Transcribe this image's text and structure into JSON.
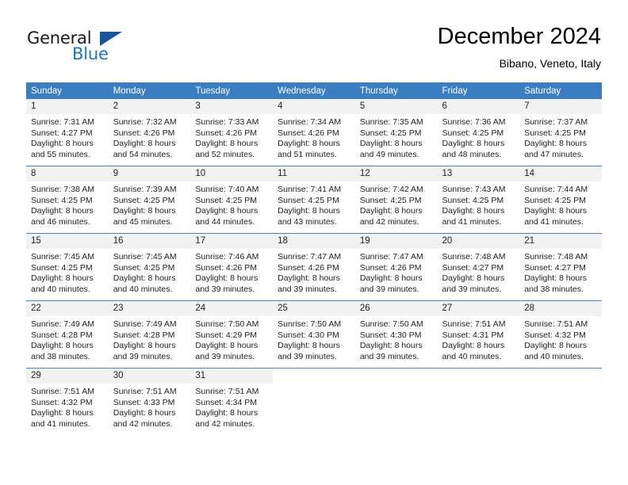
{
  "brand": {
    "line1": "General",
    "line2": "Blue",
    "triangle_color": "#15569e",
    "blue_text_color": "#1878c8"
  },
  "header": {
    "title": "December 2024",
    "location": "Bibano, Veneto, Italy"
  },
  "theme": {
    "header_row_bg": "#3a7ec1",
    "daynum_bg": "#f2f2f2",
    "row_divider": "#4a84bf"
  },
  "weekday_headers": [
    "Sunday",
    "Monday",
    "Tuesday",
    "Wednesday",
    "Thursday",
    "Friday",
    "Saturday"
  ],
  "weeks": [
    [
      {
        "day": "1",
        "sunrise": "Sunrise: 7:31 AM",
        "sunset": "Sunset: 4:27 PM",
        "daylight1": "Daylight: 8 hours",
        "daylight2": "and 55 minutes."
      },
      {
        "day": "2",
        "sunrise": "Sunrise: 7:32 AM",
        "sunset": "Sunset: 4:26 PM",
        "daylight1": "Daylight: 8 hours",
        "daylight2": "and 54 minutes."
      },
      {
        "day": "3",
        "sunrise": "Sunrise: 7:33 AM",
        "sunset": "Sunset: 4:26 PM",
        "daylight1": "Daylight: 8 hours",
        "daylight2": "and 52 minutes."
      },
      {
        "day": "4",
        "sunrise": "Sunrise: 7:34 AM",
        "sunset": "Sunset: 4:26 PM",
        "daylight1": "Daylight: 8 hours",
        "daylight2": "and 51 minutes."
      },
      {
        "day": "5",
        "sunrise": "Sunrise: 7:35 AM",
        "sunset": "Sunset: 4:25 PM",
        "daylight1": "Daylight: 8 hours",
        "daylight2": "and 49 minutes."
      },
      {
        "day": "6",
        "sunrise": "Sunrise: 7:36 AM",
        "sunset": "Sunset: 4:25 PM",
        "daylight1": "Daylight: 8 hours",
        "daylight2": "and 48 minutes."
      },
      {
        "day": "7",
        "sunrise": "Sunrise: 7:37 AM",
        "sunset": "Sunset: 4:25 PM",
        "daylight1": "Daylight: 8 hours",
        "daylight2": "and 47 minutes."
      }
    ],
    [
      {
        "day": "8",
        "sunrise": "Sunrise: 7:38 AM",
        "sunset": "Sunset: 4:25 PM",
        "daylight1": "Daylight: 8 hours",
        "daylight2": "and 46 minutes."
      },
      {
        "day": "9",
        "sunrise": "Sunrise: 7:39 AM",
        "sunset": "Sunset: 4:25 PM",
        "daylight1": "Daylight: 8 hours",
        "daylight2": "and 45 minutes."
      },
      {
        "day": "10",
        "sunrise": "Sunrise: 7:40 AM",
        "sunset": "Sunset: 4:25 PM",
        "daylight1": "Daylight: 8 hours",
        "daylight2": "and 44 minutes."
      },
      {
        "day": "11",
        "sunrise": "Sunrise: 7:41 AM",
        "sunset": "Sunset: 4:25 PM",
        "daylight1": "Daylight: 8 hours",
        "daylight2": "and 43 minutes."
      },
      {
        "day": "12",
        "sunrise": "Sunrise: 7:42 AM",
        "sunset": "Sunset: 4:25 PM",
        "daylight1": "Daylight: 8 hours",
        "daylight2": "and 42 minutes."
      },
      {
        "day": "13",
        "sunrise": "Sunrise: 7:43 AM",
        "sunset": "Sunset: 4:25 PM",
        "daylight1": "Daylight: 8 hours",
        "daylight2": "and 41 minutes."
      },
      {
        "day": "14",
        "sunrise": "Sunrise: 7:44 AM",
        "sunset": "Sunset: 4:25 PM",
        "daylight1": "Daylight: 8 hours",
        "daylight2": "and 41 minutes."
      }
    ],
    [
      {
        "day": "15",
        "sunrise": "Sunrise: 7:45 AM",
        "sunset": "Sunset: 4:25 PM",
        "daylight1": "Daylight: 8 hours",
        "daylight2": "and 40 minutes."
      },
      {
        "day": "16",
        "sunrise": "Sunrise: 7:45 AM",
        "sunset": "Sunset: 4:25 PM",
        "daylight1": "Daylight: 8 hours",
        "daylight2": "and 40 minutes."
      },
      {
        "day": "17",
        "sunrise": "Sunrise: 7:46 AM",
        "sunset": "Sunset: 4:26 PM",
        "daylight1": "Daylight: 8 hours",
        "daylight2": "and 39 minutes."
      },
      {
        "day": "18",
        "sunrise": "Sunrise: 7:47 AM",
        "sunset": "Sunset: 4:26 PM",
        "daylight1": "Daylight: 8 hours",
        "daylight2": "and 39 minutes."
      },
      {
        "day": "19",
        "sunrise": "Sunrise: 7:47 AM",
        "sunset": "Sunset: 4:26 PM",
        "daylight1": "Daylight: 8 hours",
        "daylight2": "and 39 minutes."
      },
      {
        "day": "20",
        "sunrise": "Sunrise: 7:48 AM",
        "sunset": "Sunset: 4:27 PM",
        "daylight1": "Daylight: 8 hours",
        "daylight2": "and 39 minutes."
      },
      {
        "day": "21",
        "sunrise": "Sunrise: 7:48 AM",
        "sunset": "Sunset: 4:27 PM",
        "daylight1": "Daylight: 8 hours",
        "daylight2": "and 38 minutes."
      }
    ],
    [
      {
        "day": "22",
        "sunrise": "Sunrise: 7:49 AM",
        "sunset": "Sunset: 4:28 PM",
        "daylight1": "Daylight: 8 hours",
        "daylight2": "and 38 minutes."
      },
      {
        "day": "23",
        "sunrise": "Sunrise: 7:49 AM",
        "sunset": "Sunset: 4:28 PM",
        "daylight1": "Daylight: 8 hours",
        "daylight2": "and 39 minutes."
      },
      {
        "day": "24",
        "sunrise": "Sunrise: 7:50 AM",
        "sunset": "Sunset: 4:29 PM",
        "daylight1": "Daylight: 8 hours",
        "daylight2": "and 39 minutes."
      },
      {
        "day": "25",
        "sunrise": "Sunrise: 7:50 AM",
        "sunset": "Sunset: 4:30 PM",
        "daylight1": "Daylight: 8 hours",
        "daylight2": "and 39 minutes."
      },
      {
        "day": "26",
        "sunrise": "Sunrise: 7:50 AM",
        "sunset": "Sunset: 4:30 PM",
        "daylight1": "Daylight: 8 hours",
        "daylight2": "and 39 minutes."
      },
      {
        "day": "27",
        "sunrise": "Sunrise: 7:51 AM",
        "sunset": "Sunset: 4:31 PM",
        "daylight1": "Daylight: 8 hours",
        "daylight2": "and 40 minutes."
      },
      {
        "day": "28",
        "sunrise": "Sunrise: 7:51 AM",
        "sunset": "Sunset: 4:32 PM",
        "daylight1": "Daylight: 8 hours",
        "daylight2": "and 40 minutes."
      }
    ],
    [
      {
        "day": "29",
        "sunrise": "Sunrise: 7:51 AM",
        "sunset": "Sunset: 4:32 PM",
        "daylight1": "Daylight: 8 hours",
        "daylight2": "and 41 minutes."
      },
      {
        "day": "30",
        "sunrise": "Sunrise: 7:51 AM",
        "sunset": "Sunset: 4:33 PM",
        "daylight1": "Daylight: 8 hours",
        "daylight2": "and 42 minutes."
      },
      {
        "day": "31",
        "sunrise": "Sunrise: 7:51 AM",
        "sunset": "Sunset: 4:34 PM",
        "daylight1": "Daylight: 8 hours",
        "daylight2": "and 42 minutes."
      },
      {
        "day": "",
        "sunrise": "",
        "sunset": "",
        "daylight1": "",
        "daylight2": ""
      },
      {
        "day": "",
        "sunrise": "",
        "sunset": "",
        "daylight1": "",
        "daylight2": ""
      },
      {
        "day": "",
        "sunrise": "",
        "sunset": "",
        "daylight1": "",
        "daylight2": ""
      },
      {
        "day": "",
        "sunrise": "",
        "sunset": "",
        "daylight1": "",
        "daylight2": ""
      }
    ]
  ]
}
